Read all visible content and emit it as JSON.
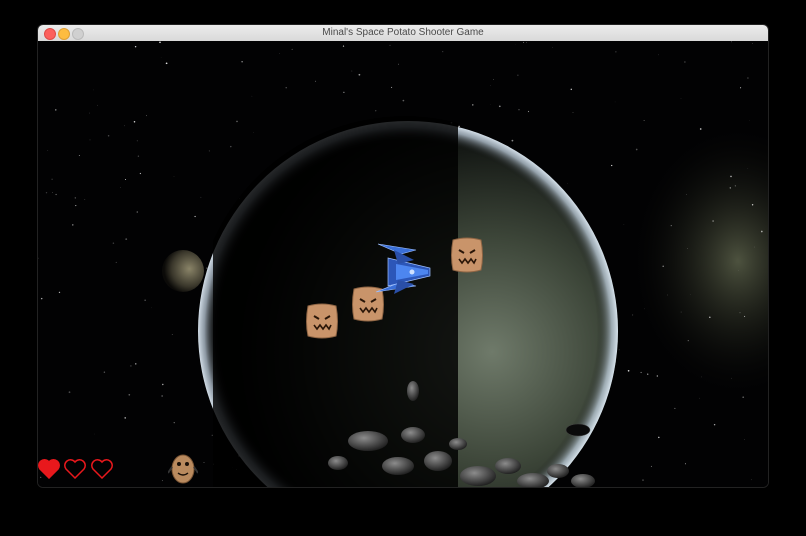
{
  "window": {
    "title": "Minal's Space Potato Shooter Game"
  },
  "hud": {
    "lives_total": 3,
    "lives_remaining": 1,
    "heart_full_color": "#e8181c",
    "heart_empty_color": "#e8181c"
  },
  "scene": {
    "background": "starfield",
    "planet": "earth-like planet",
    "moon": "small moon",
    "enemies": [
      "angry-potato",
      "angry-potato",
      "angry-potato"
    ],
    "player": "blue-spaceship",
    "player_icon": "potato-character",
    "asteroid_field": true
  },
  "colors": {
    "potato": "#c9946a",
    "ship": "#3a6fd8",
    "heart": "#e8181c"
  }
}
